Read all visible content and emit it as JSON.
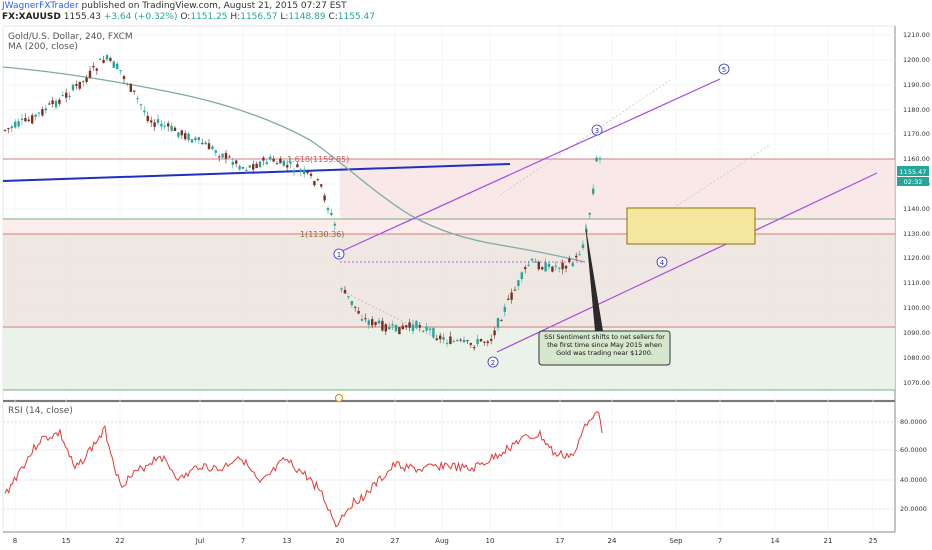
{
  "header": {
    "author": "JWagnerFXTrader",
    "published": "published on TradingView.com, August 21, 2015 07:27 EST",
    "symbol": "FX:XAUUSD",
    "last": "1155.43",
    "change": "+3.64 (+0.32%)",
    "open_label": "O:",
    "open": "1151.25",
    "high_label": "H:",
    "high": "1156.57",
    "low_label": "L:",
    "low": "1148.89",
    "close_label": "C:",
    "close": "1155.47"
  },
  "main_legend": {
    "title": "Gold/U.S. Dollar, 240, FXCM",
    "indicator": "MA (200, close)"
  },
  "rsi_legend": {
    "title": "RSI (14, close)"
  },
  "price_axis": {
    "ticks": [
      "1210.00",
      "1200.00",
      "1190.00",
      "1180.00",
      "1170.00",
      "1160.00",
      "1150.00",
      "1140.00",
      "1130.00",
      "1120.00",
      "1110.00",
      "1100.00",
      "1090.00",
      "1080.00",
      "1070.00"
    ]
  },
  "price_badges": {
    "last": "1155.47",
    "time": "02:32"
  },
  "rsi_axis": {
    "ticks": [
      "80.0000",
      "60.0000",
      "40.0000",
      "20.0000"
    ]
  },
  "time_axis": {
    "ticks": [
      "8",
      "15",
      "22",
      "Jul",
      "7",
      "13",
      "20",
      "27",
      "Aug",
      "10",
      "17",
      "24",
      "Sep",
      "7",
      "14",
      "21",
      "25"
    ]
  },
  "annotations": {
    "fib_1618": "1.618(1159.85)",
    "fib_1": "1(1130.36)",
    "waves": [
      "1",
      "2",
      "3",
      "4",
      "5"
    ],
    "callout": "SSI Sentiment shifts to net sellers for the first time since May 2015 when Gold was trading near $1200."
  },
  "colors": {
    "up": "#26a69a",
    "down": "#7a2e22",
    "ma": "#7fa9a9",
    "rsi": "#e53935",
    "channel": "#a64bdf",
    "trendline": "#1f2fc2",
    "wave_label": "#2c33c9",
    "zone_fill": "#f5e6a0",
    "zone_border": "#b59b00",
    "resistance": "#c75a5a"
  }
}
